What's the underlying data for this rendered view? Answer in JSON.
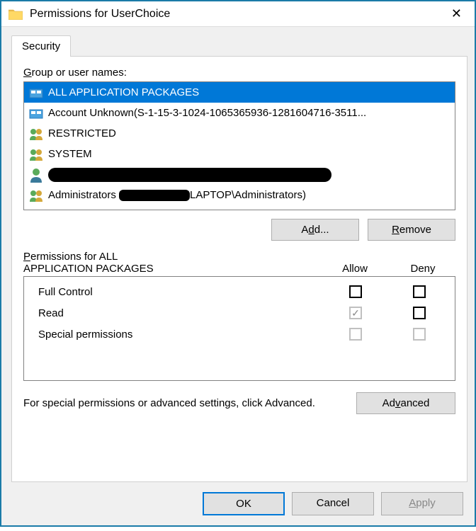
{
  "window": {
    "title": "Permissions for UserChoice"
  },
  "tab": {
    "security": "Security"
  },
  "labels": {
    "group_or_users": "Group or user names:",
    "permissions_for_prefix": "Permissions for ALL APPLICATION PACKAGES",
    "allow": "Allow",
    "deny": "Deny",
    "advanced_text": "For special permissions or advanced settings, click Advanced."
  },
  "users": [
    {
      "name": "ALL APPLICATION PACKAGES",
      "icon": "package",
      "selected": true
    },
    {
      "name": "Account Unknown(S-1-15-3-1024-1065365936-1281604716-3511...",
      "icon": "package",
      "selected": false
    },
    {
      "name": "RESTRICTED",
      "icon": "group",
      "selected": false
    },
    {
      "name": "SYSTEM",
      "icon": "group",
      "selected": false
    },
    {
      "name": "[redacted]",
      "icon": "user",
      "selected": false,
      "redacted": true
    },
    {
      "name": "Administrators ([redacted]LAPTOP\\Administrators)",
      "icon": "group",
      "selected": false,
      "partial_redact": true
    }
  ],
  "permissions": [
    {
      "name": "Full Control",
      "allow": false,
      "allow_disabled": false,
      "deny": false,
      "deny_disabled": false
    },
    {
      "name": "Read",
      "allow": true,
      "allow_disabled": true,
      "deny": false,
      "deny_disabled": false
    },
    {
      "name": "Special permissions",
      "allow": false,
      "allow_disabled": true,
      "deny": false,
      "deny_disabled": true
    }
  ],
  "buttons": {
    "add": "Add...",
    "remove": "Remove",
    "advanced": "Advanced",
    "ok": "OK",
    "cancel": "Cancel",
    "apply": "Apply"
  }
}
